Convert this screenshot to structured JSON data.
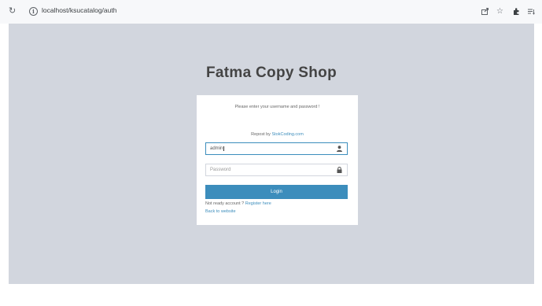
{
  "browser": {
    "url": "localhost/ksucatalog/auth",
    "icons": [
      "reload-icon",
      "info-icon",
      "share-icon",
      "star-icon",
      "extensions-icon",
      "reading-list-icon"
    ]
  },
  "page": {
    "title": "Fatma Copy Shop",
    "message": "Please enter your username and password !",
    "repost_prefix": "Repost by",
    "repost_link": "StokCoding.com",
    "username_value": "admin",
    "password_placeholder": "Password",
    "login_label": "Login",
    "not_ready_text": "Not ready account ?",
    "register_link": "Register here",
    "back_link": "Back to website",
    "colors": {
      "background": "#d2d6de",
      "primary": "#3c8dbc",
      "card": "#ffffff"
    }
  }
}
